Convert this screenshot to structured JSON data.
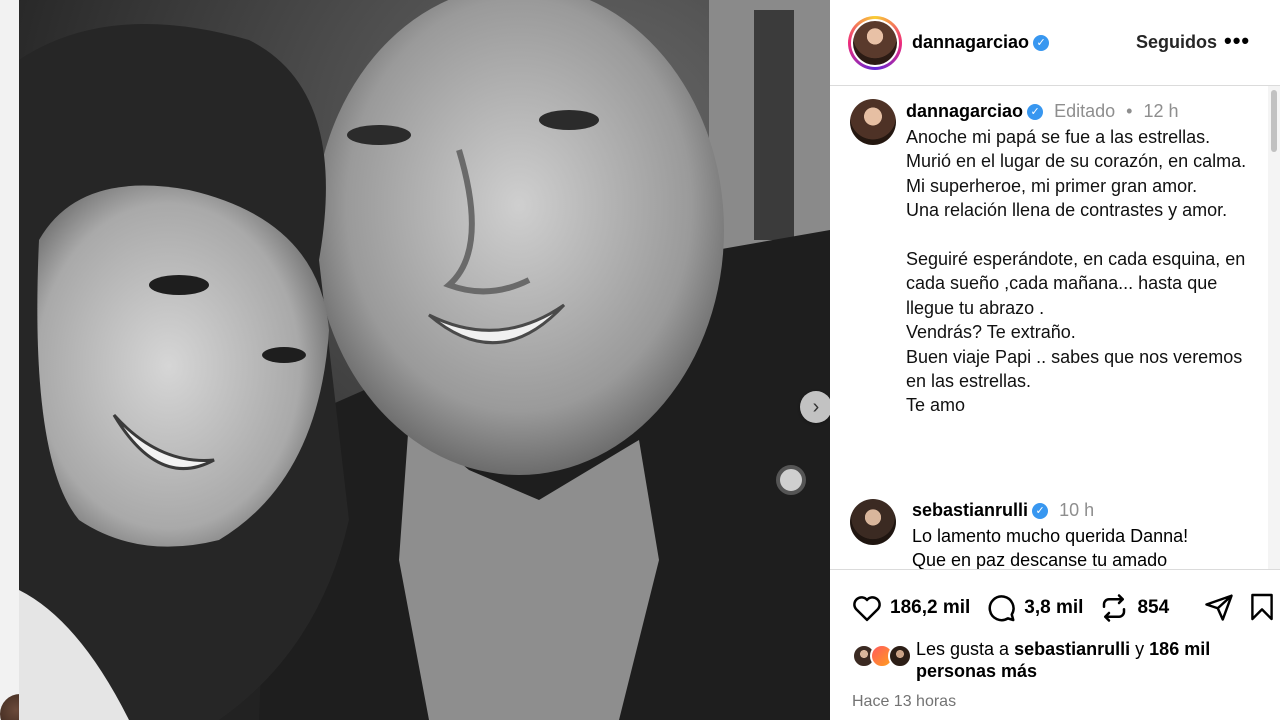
{
  "post": {
    "author": "dannagarciao",
    "follow_label": "Seguidos",
    "more_label": "•••",
    "verified_mark": "✓",
    "next_arrow": "›"
  },
  "caption": {
    "author": "dannagarciao",
    "edited": "Editado",
    "separator": "•",
    "time": "12 h",
    "text": "Anoche mi papá se fue a las estrellas.\nMurió en el lugar de su corazón, en calma.\nMi superheroe, mi primer gran amor.\nUna relación llena de contrastes y amor.\n\nSeguiré esperándote, en cada esquina, en cada sueño ,cada mañana... hasta que llegue tu abrazo .\nVendrás? Te extraño.\nBuen viaje Papi .. sabes que nos veremos en las estrellas.\nTe amo"
  },
  "comment": {
    "author": "sebastianrulli",
    "time": "10 h",
    "text": "Lo lamento mucho querida Danna!\nQue en paz descanse tu amado"
  },
  "actions": {
    "likes": "186,2 mil",
    "comments": "3,8 mil",
    "reposts": "854"
  },
  "likes_summary": {
    "prefix": "Les gusta a",
    "user": "sebastianrulli",
    "middle": "y",
    "count": "186 mil",
    "suffix": "personas más"
  },
  "timestamp": "Hace 13 horas",
  "icons": [
    "heart-icon",
    "comment-icon",
    "repost-icon",
    "share-icon",
    "bookmark-icon",
    "chevron-right-icon",
    "verified-icon",
    "more-icon"
  ]
}
